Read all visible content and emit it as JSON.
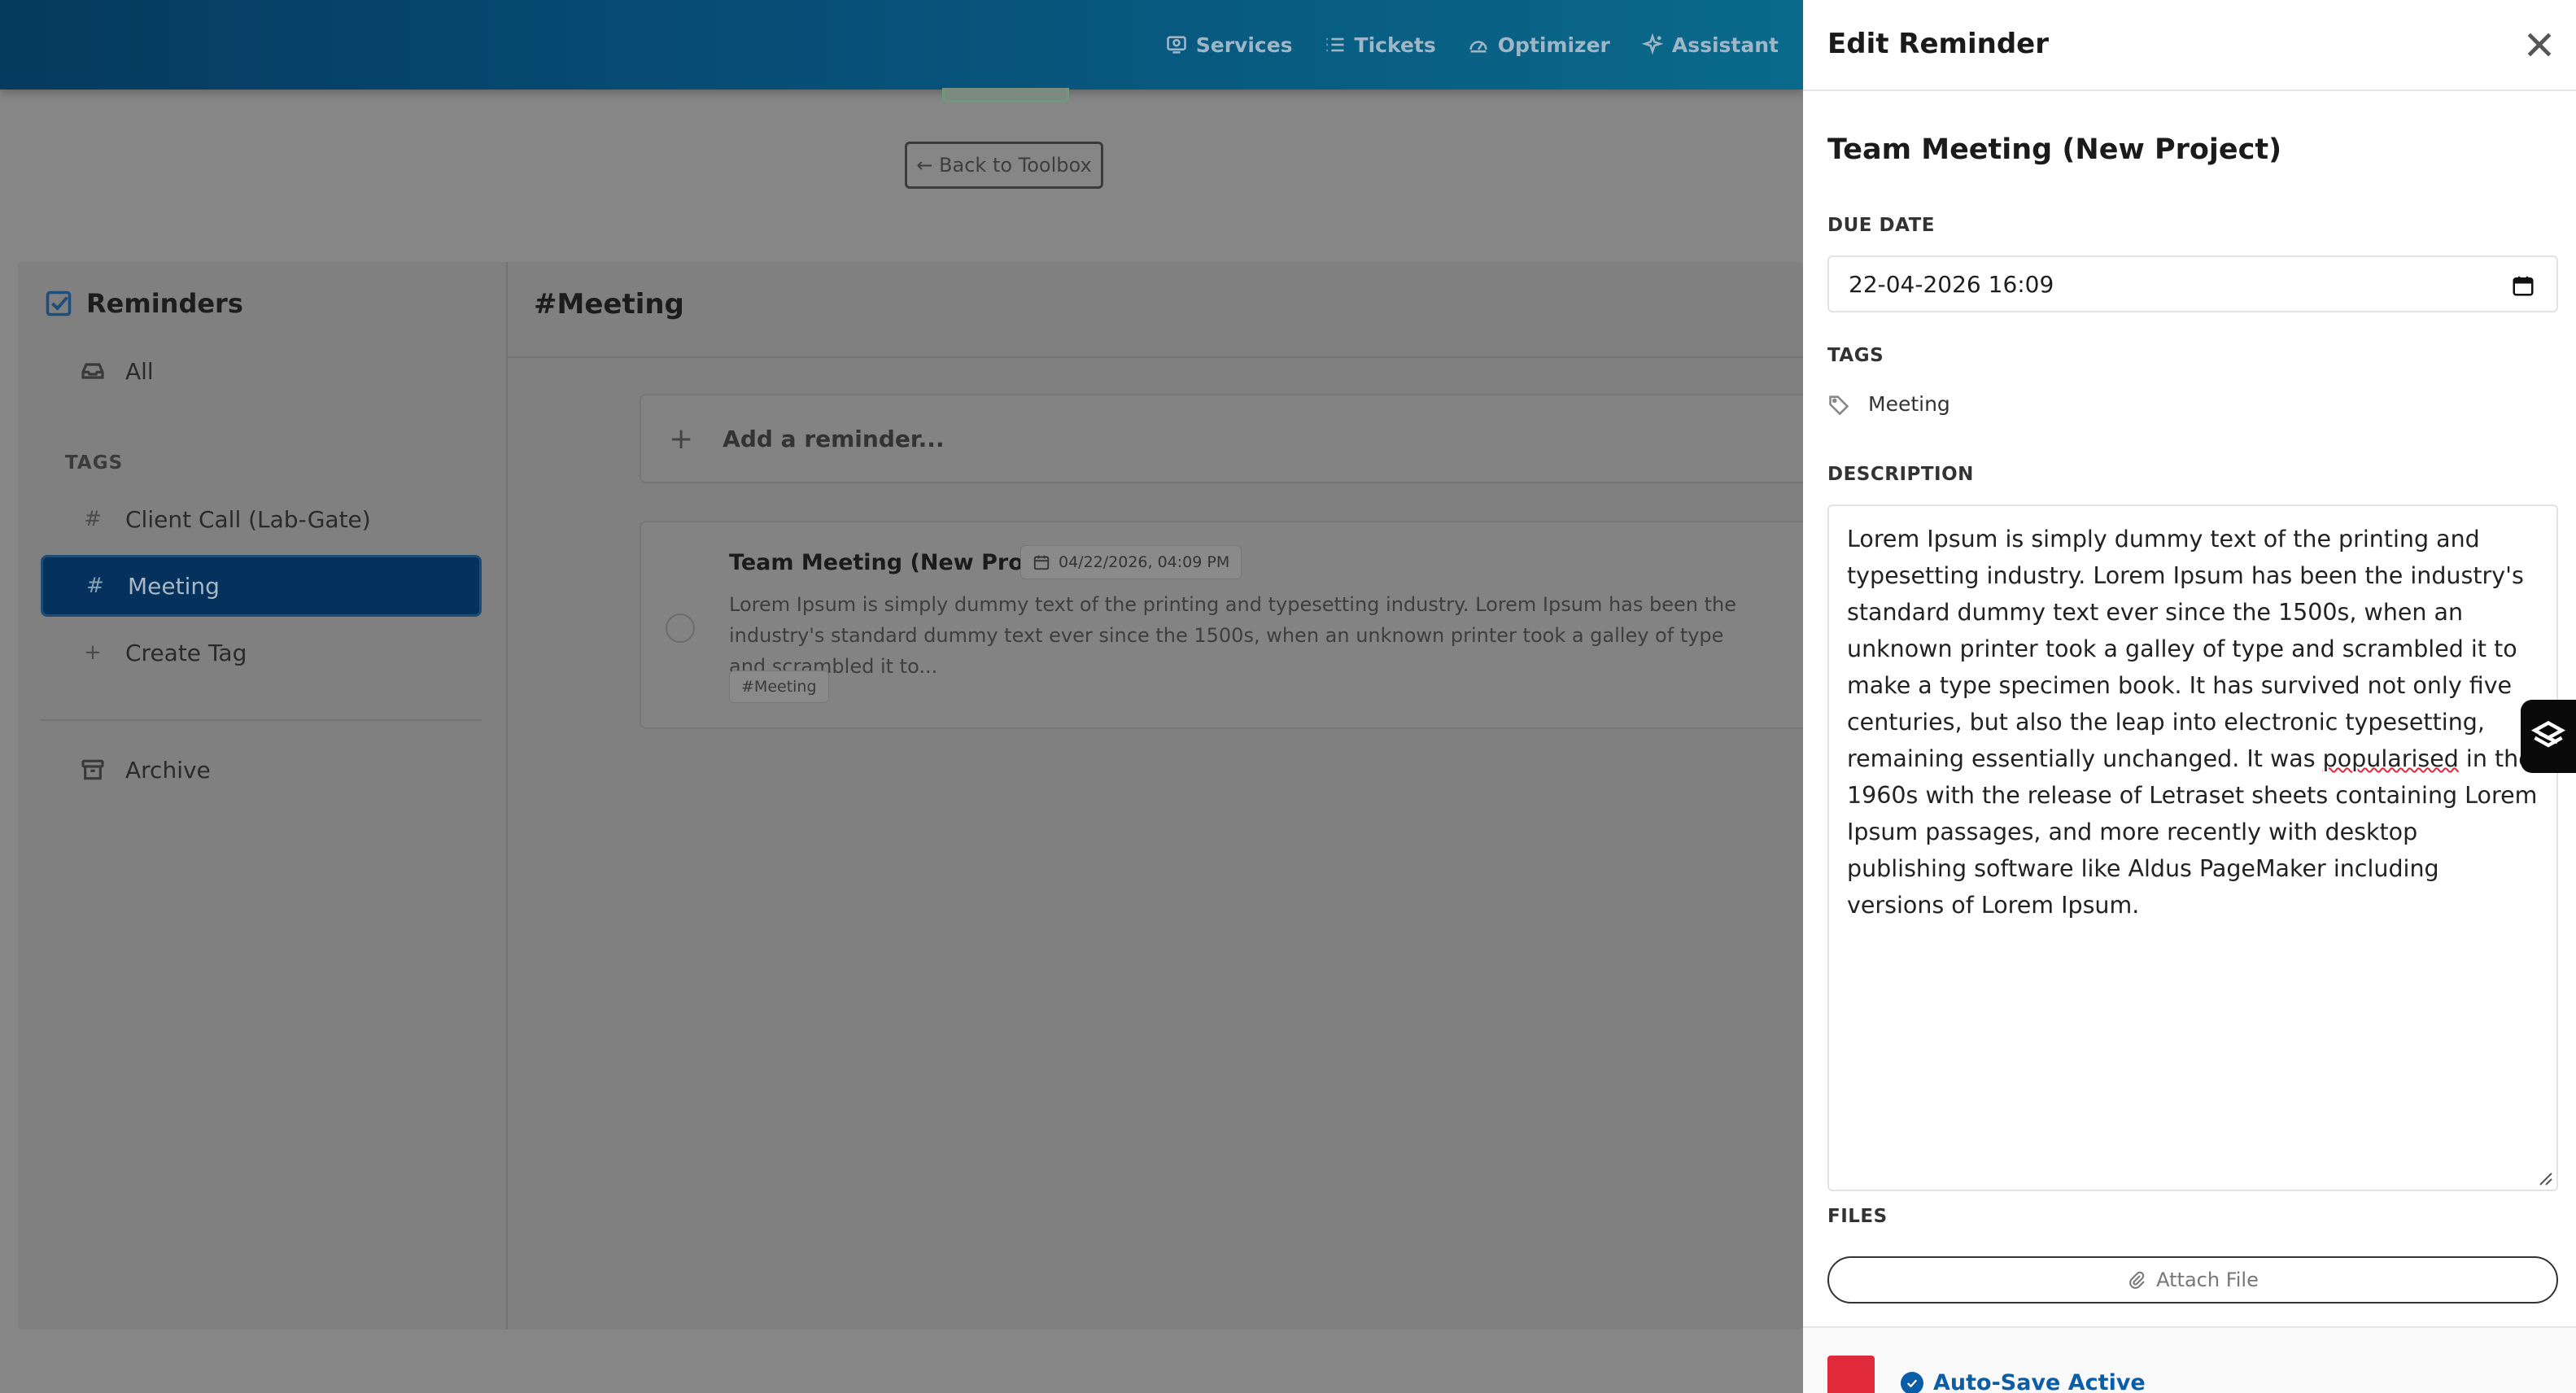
{
  "nav": {
    "items": [
      {
        "label": "Services",
        "icon": "services-icon"
      },
      {
        "label": "Tickets",
        "icon": "list-icon"
      },
      {
        "label": "Optimizer",
        "icon": "gauge-icon"
      },
      {
        "label": "Assistant",
        "icon": "sparkle-icon"
      }
    ]
  },
  "page": {
    "back_label": "← Back to Toolbox"
  },
  "sidebar": {
    "title": "Reminders",
    "all_label": "All",
    "tags_heading": "TAGS",
    "tags": [
      {
        "label": "Client Call (Lab-Gate)",
        "active": false
      },
      {
        "label": "Meeting",
        "active": true
      }
    ],
    "create_tag_label": "Create Tag",
    "archive_label": "Archive"
  },
  "main": {
    "title": "#Meeting",
    "add_placeholder": "Add a reminder...",
    "reminders": [
      {
        "title": "Team Meeting (New Project)",
        "date": "04/22/2026, 04:09 PM",
        "description": "Lorem Ipsum is simply dummy text of the printing and typesetting industry. Lorem Ipsum has been the industry's standard dummy text ever since the 1500s, when an unknown printer took a galley of type and scrambled it to...",
        "tag": "#Meeting"
      }
    ]
  },
  "drawer": {
    "header_title": "Edit Reminder",
    "reminder_title": "Team Meeting (New Project)",
    "due_date_label": "DUE DATE",
    "due_date_value": "22-04-2026 16:09",
    "tags_label": "TAGS",
    "tag_value": "Meeting",
    "description_label": "DESCRIPTION",
    "description_before": "Lorem Ipsum is simply dummy text of the printing and typesetting industry. Lorem Ipsum has been the industry's standard dummy text ever since the 1500s, when an unknown printer took a galley of type and scrambled it to make a type specimen book. It has survived not only five centuries, but also the leap into electronic typesetting, remaining essentially unchanged. It was ",
    "description_misspelled": "popularised",
    "description_after": " in the 1960s with the release of Letraset sheets containing Lorem Ipsum passages, and more recently with desktop publishing software like Aldus PageMaker including versions of Lorem Ipsum.",
    "files_label": "FILES",
    "attach_label": "Attach File",
    "autosave_label": "Auto-Save Active"
  },
  "colors": {
    "header_gradient_start": "#063a5e",
    "header_gradient_end": "#0a6a8c",
    "active_tag_bg": "#04325c",
    "autosave_blue": "#0a5ea8",
    "footer_red": "#e0293b",
    "overlay_gray": "#868686"
  }
}
